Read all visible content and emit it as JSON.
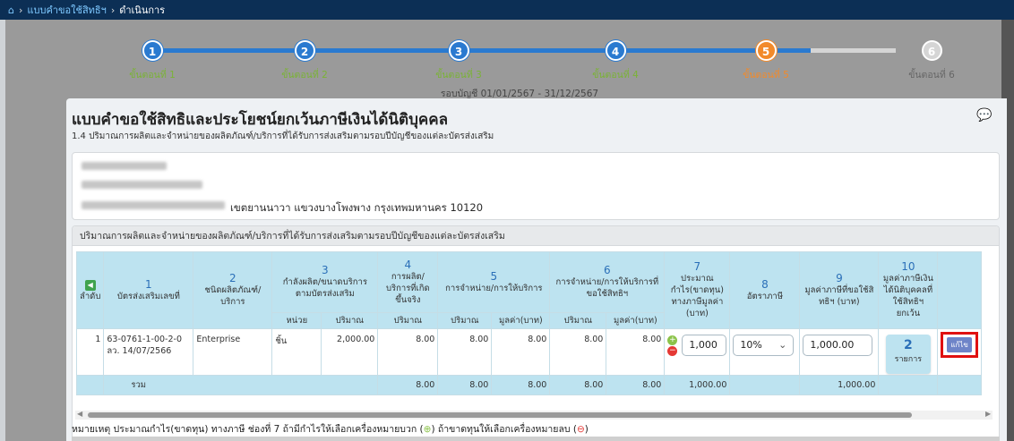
{
  "breadcrumb": {
    "home_icon": "home-icon",
    "link": "แบบคำขอใช้สิทธิฯ",
    "current": "ดำเนินการ"
  },
  "stepper": {
    "steps": [
      {
        "num": "1",
        "label": "ขั้นตอนที่ 1",
        "state": "done"
      },
      {
        "num": "2",
        "label": "ขั้นตอนที่ 2",
        "state": "done"
      },
      {
        "num": "3",
        "label": "ขั้นตอนที่ 3",
        "state": "done"
      },
      {
        "num": "4",
        "label": "ขั้นตอนที่ 4",
        "state": "done"
      },
      {
        "num": "5",
        "label": "ขั้นตอนที่ 5",
        "state": "active"
      },
      {
        "num": "6",
        "label": "ขั้นตอนที่ 6",
        "state": "disabled"
      }
    ],
    "period": "รอบบัญชี 01/01/2567 - 31/12/2567"
  },
  "form": {
    "title": "แบบคำขอใช้สิทธิและประโยชน์ยกเว้นภาษีเงินได้นิติบุคคล",
    "subtitle": "1.4 ปริมาณการผลิตและจำหน่ายของผลิตภัณฑ์/บริการที่ได้รับการส่งเสริมตามรอบปีบัญชีของแต่ละบัตรส่งเสริม",
    "comment_icon": "comment-icon"
  },
  "address": {
    "visible_line": "เขตยานนาวา แขวงบางโพงพาง กรุงเทพมหานคร 10120"
  },
  "table": {
    "caption": "ปริมาณการผลิตและจำหน่ายของผลิตภัณฑ์/บริการที่ได้รับการส่งเสริมตามรอบปีบัญชีของแต่ละบัตรส่งเสริม",
    "headers": {
      "seq": "ลำดับ",
      "c1_num": "1",
      "c1": "บัตรส่งเสริมเลขที่",
      "c2_num": "2",
      "c2": "ชนิดผลิตภัณฑ์/บริการ",
      "c3_num": "3",
      "c3": "กำลังผลิต/ขนาดบริการตามบัตรส่งเสริม",
      "c4_num": "4",
      "c4": "การผลิต/บริการที่เกิดขึ้นจริง",
      "c5_num": "5",
      "c5": "การจำหน่าย/การให้บริการ",
      "c6_num": "6",
      "c6": "การจำหน่าย/การให้บริการที่ขอใช้สิทธิฯ",
      "c7_num": "7",
      "c7": "ประมาณกำไร(ขาดทุน) ทางภาษีมูลค่า (บาท)",
      "c8_num": "8",
      "c8": "อัตราภาษี",
      "c9_num": "9",
      "c9": "มูลค่าภาษีที่ขอใช้สิทธิฯ (บาท)",
      "c10_num": "10",
      "c10": "มูลค่าภาษีเงินได้นิติบุคคลที่ใช้สิทธิฯ ยกเว้น",
      "unit": "หน่วย",
      "qty": "ปริมาณ",
      "value": "มูลค่า(บาท)"
    },
    "row": {
      "seq": "1",
      "card_no": "63-0761-1-00-2-0",
      "card_date": "ลว. 14/07/2566",
      "product": "Enterprise",
      "unit": "ชิ้น",
      "capacity_qty": "2,000.00",
      "actual_qty": "8.00",
      "sales_qty": "8.00",
      "sales_value": "8.00",
      "claim_qty": "8.00",
      "claim_value": "8.00",
      "profit_input": "1,000",
      "tax_rate": "10%",
      "tax_value": "1,000.00",
      "items_count": "2",
      "items_unit": "รายการ",
      "edit_label": "แก้ไข"
    },
    "total": {
      "label": "รวม",
      "actual_qty": "8.00",
      "sales_qty": "8.00",
      "sales_value": "8.00",
      "claim_qty": "8.00",
      "claim_value": "8.00",
      "profit": "1,000.00",
      "tax_value": "1,000.00"
    }
  },
  "note": {
    "prefix": "หมายเหตุ ประมาณกำไร(ขาดทุน) ทางภาษี ช่องที่ 7 ถ้ามีกำไรให้เลือกเครื่องหมายบวก (",
    "middle": ") ถ้าขาดทุนให้เลือกเครื่องหมายลบ (",
    "suffix": ")"
  }
}
